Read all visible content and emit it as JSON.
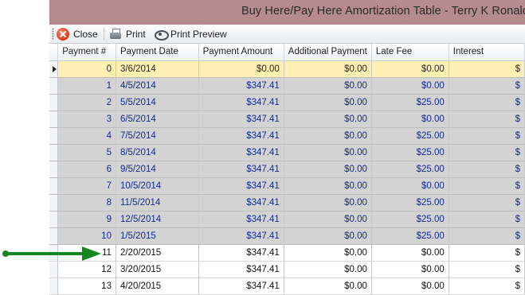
{
  "window": {
    "title": "Buy Here/Pay Here Amortization Table - Terry K Ronald"
  },
  "toolbar": {
    "close_label": "Close",
    "print_label": "Print",
    "preview_label": "Print Preview"
  },
  "columns": [
    "Payment #",
    "Payment Date",
    "Payment Amount",
    "Additional Payment",
    "Late Fee",
    "Interest"
  ],
  "rows": [
    {
      "num": "0",
      "date": "3/6/2014",
      "amount": "$0.00",
      "additional": "$0.00",
      "late": "$0.00",
      "interest": "$",
      "status": "current"
    },
    {
      "num": "1",
      "date": "4/5/2014",
      "amount": "$347.41",
      "additional": "$0.00",
      "late": "$0.00",
      "interest": "$",
      "status": "paid"
    },
    {
      "num": "2",
      "date": "5/5/2014",
      "amount": "$347.41",
      "additional": "$0.00",
      "late": "$25.00",
      "interest": "$",
      "status": "paid"
    },
    {
      "num": "3",
      "date": "6/5/2014",
      "amount": "$347.41",
      "additional": "$0.00",
      "late": "$0.00",
      "interest": "$",
      "status": "paid"
    },
    {
      "num": "4",
      "date": "7/5/2014",
      "amount": "$347.41",
      "additional": "$0.00",
      "late": "$25.00",
      "interest": "$",
      "status": "paid"
    },
    {
      "num": "5",
      "date": "8/5/2014",
      "amount": "$347.41",
      "additional": "$0.00",
      "late": "$25.00",
      "interest": "$",
      "status": "paid"
    },
    {
      "num": "6",
      "date": "9/5/2014",
      "amount": "$347.41",
      "additional": "$0.00",
      "late": "$25.00",
      "interest": "$",
      "status": "paid"
    },
    {
      "num": "7",
      "date": "10/5/2014",
      "amount": "$347.41",
      "additional": "$0.00",
      "late": "$0.00",
      "interest": "$",
      "status": "paid"
    },
    {
      "num": "8",
      "date": "11/5/2014",
      "amount": "$347.41",
      "additional": "$0.00",
      "late": "$25.00",
      "interest": "$",
      "status": "paid"
    },
    {
      "num": "9",
      "date": "12/5/2014",
      "amount": "$347.41",
      "additional": "$0.00",
      "late": "$25.00",
      "interest": "$",
      "status": "paid"
    },
    {
      "num": "10",
      "date": "1/5/2015",
      "amount": "$347.41",
      "additional": "$0.00",
      "late": "$25.00",
      "interest": "$",
      "status": "paid"
    },
    {
      "num": "11",
      "date": "2/20/2015",
      "amount": "$347.41",
      "additional": "$0.00",
      "late": "$0.00",
      "interest": "$",
      "status": "future"
    },
    {
      "num": "12",
      "date": "3/20/2015",
      "amount": "$347.41",
      "additional": "$0.00",
      "late": "$0.00",
      "interest": "$",
      "status": "future"
    },
    {
      "num": "13",
      "date": "4/20/2015",
      "amount": "$347.41",
      "additional": "$0.00",
      "late": "$0.00",
      "interest": "$",
      "status": "future"
    }
  ],
  "icons": {
    "close": "close-icon",
    "print": "printer-icon",
    "preview": "print-preview-icon",
    "row_indicator": "current-row-indicator-icon",
    "annotation": "green-arrow-icon"
  },
  "colors": {
    "titlebar": "#b58b8d",
    "current_row": "#ffefb3",
    "paid_row": "#d3d3d3",
    "paid_text": "#142a8c",
    "arrow": "#16861f"
  }
}
